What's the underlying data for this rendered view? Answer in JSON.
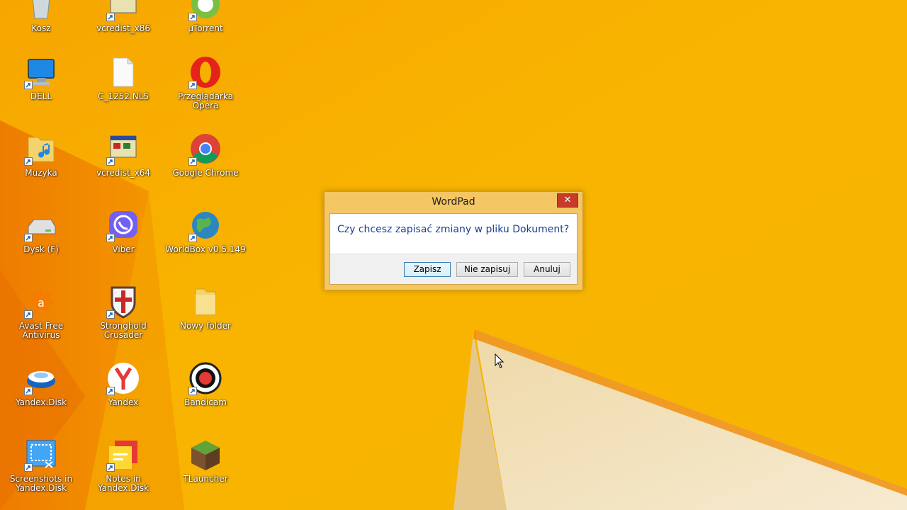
{
  "desktop": {
    "icons": [
      {
        "label": "Kosz",
        "icon": "recycle-bin-icon"
      },
      {
        "label": "vcredist_x86",
        "icon": "installer-icon"
      },
      {
        "label": "µTorrent",
        "icon": "utorrent-icon"
      },
      {
        "label": "DELL",
        "icon": "computer-icon"
      },
      {
        "label": "C_1252.NLS",
        "icon": "file-icon"
      },
      {
        "label": "Przeglądarka Opera",
        "icon": "opera-icon"
      },
      {
        "label": "Muzyka",
        "icon": "music-folder-icon"
      },
      {
        "label": "vcredist_x64",
        "icon": "installer-icon"
      },
      {
        "label": "Google Chrome",
        "icon": "chrome-icon"
      },
      {
        "label": "Dysk (F)",
        "icon": "drive-icon"
      },
      {
        "label": "Viber",
        "icon": "viber-icon"
      },
      {
        "label": "WorldBox v0.5.149",
        "icon": "globe-icon"
      },
      {
        "label": "Avast Free Antivirus",
        "icon": "avast-icon"
      },
      {
        "label": "Stronghold Crusader",
        "icon": "shield-icon"
      },
      {
        "label": "Nowy folder",
        "icon": "folder-icon"
      },
      {
        "label": "Yandex.Disk",
        "icon": "yandex-disk-icon"
      },
      {
        "label": "Yandex",
        "icon": "yandex-icon"
      },
      {
        "label": "Bandicam",
        "icon": "bandicam-icon"
      },
      {
        "label": "Screenshots in Yandex.Disk",
        "icon": "screenshot-icon"
      },
      {
        "label": "Notes in Yandex.Disk",
        "icon": "notes-icon"
      },
      {
        "label": "TLauncher",
        "icon": "minecraft-icon"
      }
    ]
  },
  "dialog": {
    "title": "WordPad",
    "close_symbol": "✕",
    "message": "Czy chcesz zapisać zmiany w pliku Dokument?",
    "buttons": {
      "save": "Zapisz",
      "dont_save": "Nie zapisuj",
      "cancel": "Anuluj"
    }
  },
  "colors": {
    "wallpaper_main": "#f6b000",
    "wallpaper_dark": "#ef8a00",
    "dialog_frame": "#f5c664",
    "close_button": "#c73b2b",
    "message_text": "#1c3f8f"
  }
}
